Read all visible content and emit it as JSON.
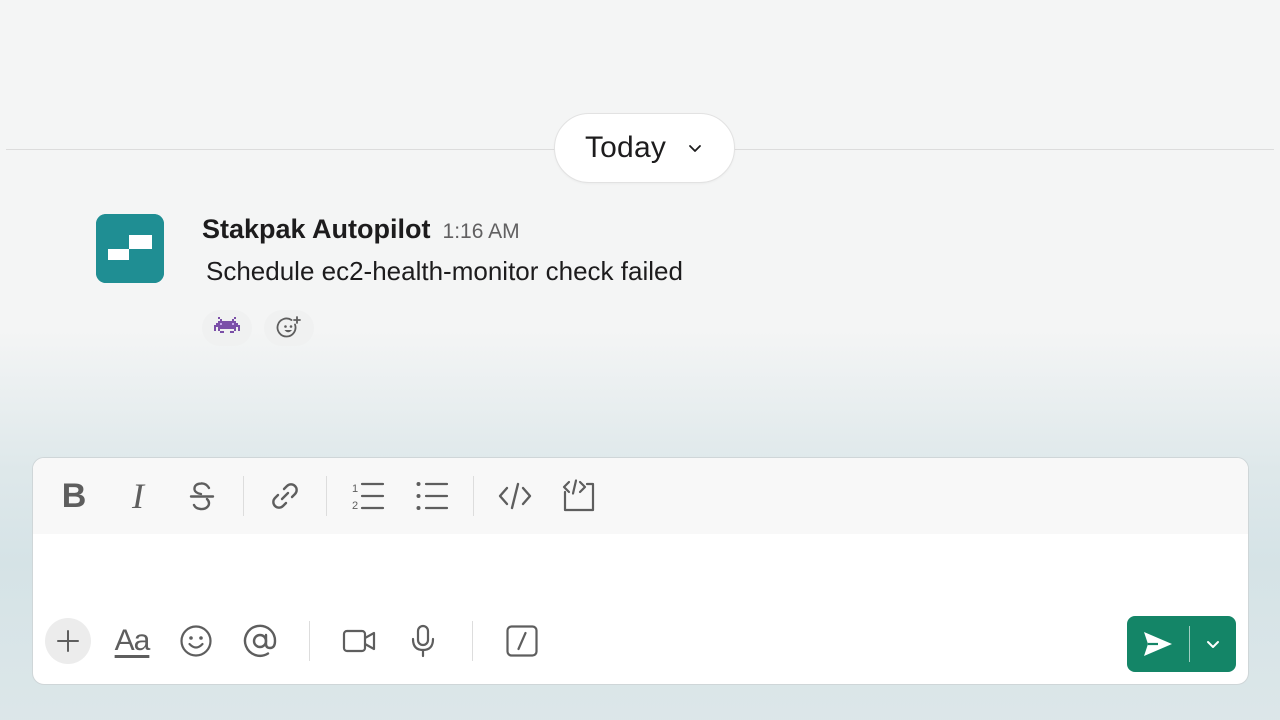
{
  "date_separator": {
    "label": "Today"
  },
  "message": {
    "sender": "Stakpak Autopilot",
    "time": "1:16 AM",
    "text": "Schedule ec2-health-monitor check failed",
    "reactions": [
      {
        "icon": "alien-monster-icon"
      },
      {
        "icon": "add-reaction-icon"
      }
    ]
  },
  "composer": {
    "formatting": [
      "bold",
      "italic",
      "strikethrough",
      "link",
      "ordered-list",
      "bulleted-list",
      "code",
      "code-block"
    ],
    "bold_label": "B",
    "italic_label": "I",
    "text_format_label": "Aa",
    "actions": [
      "attach",
      "text-format",
      "emoji",
      "mention",
      "video",
      "audio",
      "slash-command"
    ]
  },
  "colors": {
    "brand_teal": "#1f8e93",
    "send_green": "#148567",
    "background": "#f4f5f5"
  }
}
